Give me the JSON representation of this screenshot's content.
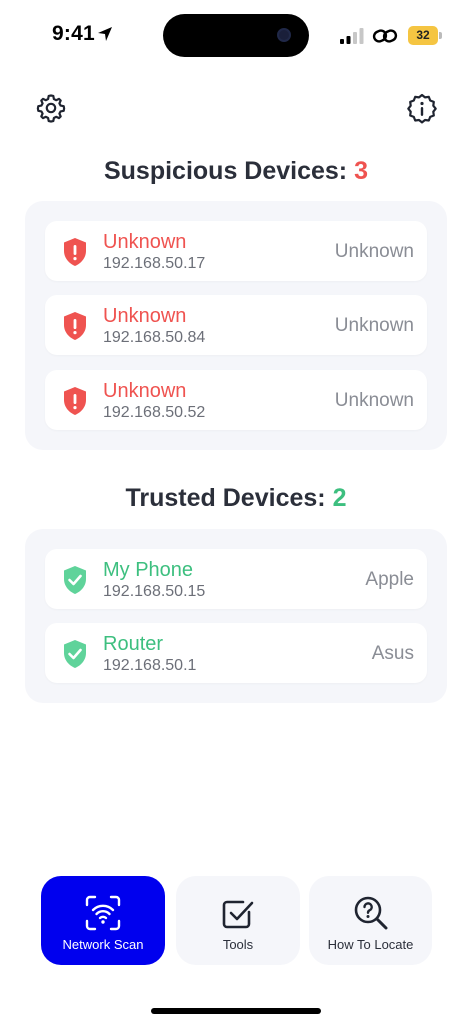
{
  "status_bar": {
    "time": "9:41",
    "battery_level": "32",
    "battery_color": "#f5c542"
  },
  "header": {
    "settings_icon": "gear-icon",
    "info_icon": "info-icon"
  },
  "suspicious": {
    "title": "Suspicious Devices:",
    "count": "3",
    "accent": "#ef5350",
    "devices": [
      {
        "name": "Unknown",
        "ip": "192.168.50.17",
        "vendor": "Unknown"
      },
      {
        "name": "Unknown",
        "ip": "192.168.50.84",
        "vendor": "Unknown"
      },
      {
        "name": "Unknown",
        "ip": "192.168.50.52",
        "vendor": "Unknown"
      }
    ]
  },
  "trusted": {
    "title": "Trusted Devices:",
    "count": "2",
    "accent": "#3dbf7f",
    "devices": [
      {
        "name": "My Phone",
        "ip": "192.168.50.15",
        "vendor": "Apple"
      },
      {
        "name": "Router",
        "ip": "192.168.50.1",
        "vendor": "Asus"
      }
    ]
  },
  "nav": {
    "active_color": "#0000ee",
    "items": [
      {
        "label": "Network Scan",
        "icon": "wifi-scan-icon"
      },
      {
        "label": "Tools",
        "icon": "checkbox-icon"
      },
      {
        "label": "How To Locate",
        "icon": "search-question-icon"
      }
    ]
  }
}
